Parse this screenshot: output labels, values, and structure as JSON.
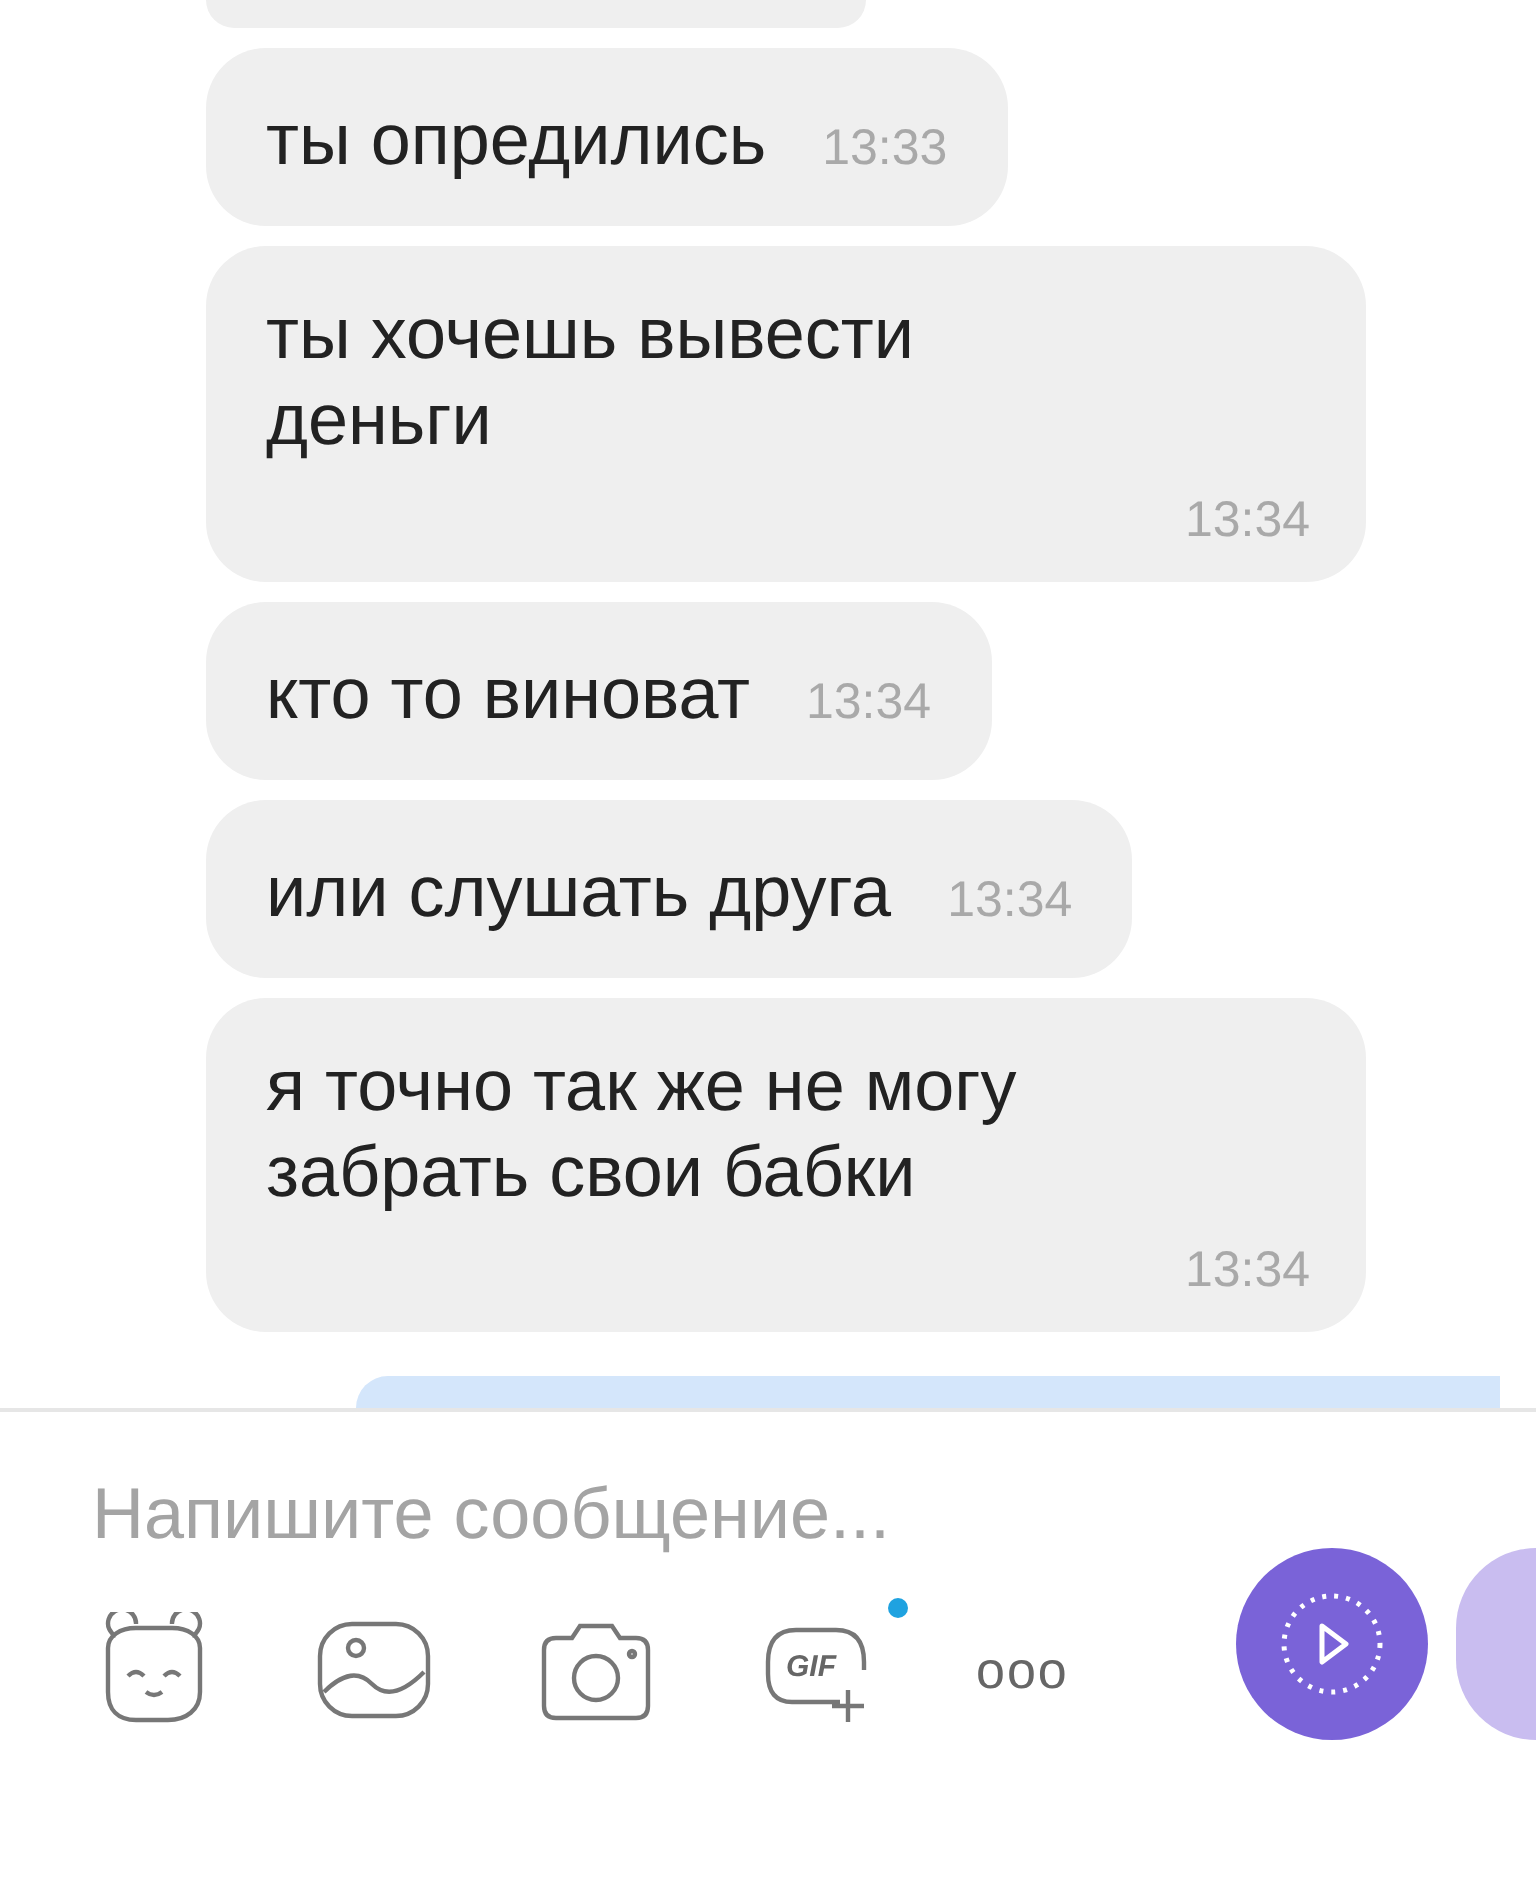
{
  "messages": [
    {
      "kind": "inline",
      "text": "ты опредились",
      "time": "13:33"
    },
    {
      "kind": "stacked",
      "text": "ты хочешь вывести деньги",
      "time": "13:34"
    },
    {
      "kind": "inline",
      "text": "кто то виноват",
      "time": "13:34"
    },
    {
      "kind": "inline",
      "text": "или слушать друга",
      "time": "13:34"
    },
    {
      "kind": "stacked",
      "text": "я точно так же не могу забрать свои бабки",
      "time": "13:34"
    }
  ],
  "composer": {
    "placeholder": "Напишите сообщение...",
    "gif_label": "GIF",
    "gif_new": true,
    "more": "ooo"
  }
}
